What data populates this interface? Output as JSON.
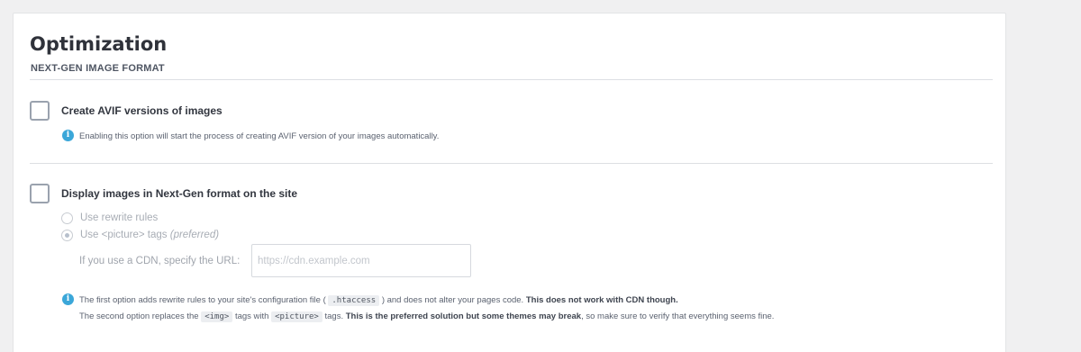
{
  "section": {
    "title": "Optimization",
    "subtitle": "NEXT-GEN IMAGE FORMAT"
  },
  "avif": {
    "label": "Create AVIF versions of images",
    "checked": false,
    "info": "Enabling this option will start the process of creating AVIF version of your images automatically."
  },
  "display": {
    "label": "Display images in Next-Gen format on the site",
    "checked": false,
    "options": {
      "rewrite": "Use rewrite rules",
      "picture": "Use <picture> tags",
      "picture_note": "(preferred)",
      "selected": "picture"
    },
    "cdn": {
      "label": "If you use a CDN, specify the URL:",
      "placeholder": "https://cdn.example.com",
      "value": ""
    },
    "info": {
      "line1_a": "The first option adds rewrite rules to your site's configuration file (",
      "line1_code": ".htaccess",
      "line1_b": ") and does not alter your pages code.",
      "line1_bold": "This does not work with CDN though.",
      "line2_a": "The second option replaces the",
      "line2_code1": "<img>",
      "line2_b": "tags with",
      "line2_code2": "<picture>",
      "line2_c": "tags.",
      "line2_bold": "This is the preferred solution but some themes may break",
      "line2_d": ", so make sure to verify that everything seems fine."
    }
  },
  "colors": {
    "background": "#f0f0f1",
    "panel": "#ffffff",
    "info_icon": "#3ba7d9"
  }
}
